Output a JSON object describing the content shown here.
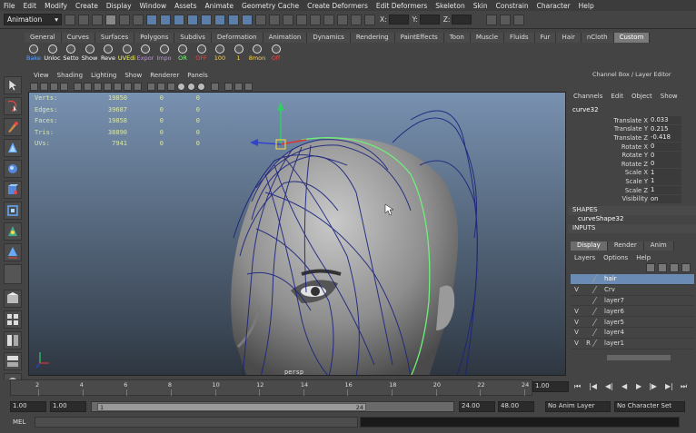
{
  "menubar": [
    "File",
    "Edit",
    "Modify",
    "Create",
    "Display",
    "Window",
    "Assets",
    "Animate",
    "Geometry Cache",
    "Create Deformers",
    "Edit Deformers",
    "Skeleton",
    "Skin",
    "Constrain",
    "Character",
    "Help"
  ],
  "status": {
    "mode": "Animation",
    "x_label": "X:",
    "y_label": "Y:",
    "z_label": "Z:"
  },
  "shelf_tabs": [
    "General",
    "Curves",
    "Surfaces",
    "Polygons",
    "Subdivs",
    "Deformation",
    "Animation",
    "Dynamics",
    "Rendering",
    "PaintEffects",
    "Toon",
    "Muscle",
    "Fluids",
    "Fur",
    "Hair",
    "nCloth",
    "Custom"
  ],
  "shelf_buttons": [
    {
      "label": "Bake",
      "color": "#5aa0ff"
    },
    {
      "label": "Unloc",
      "color": "#ffffff"
    },
    {
      "label": "Setto",
      "color": "#ffffff"
    },
    {
      "label": "Show",
      "color": "#ffffff"
    },
    {
      "label": "Reve",
      "color": "#ffffff"
    },
    {
      "label": "UVEdi",
      "color": "#ffff60"
    },
    {
      "label": "Expor",
      "color": "#d080ff"
    },
    {
      "label": "Impo",
      "color": "#d080ff"
    },
    {
      "label": "OR",
      "color": "#80ff80"
    },
    {
      "label": "OFF",
      "color": "#ff4040"
    },
    {
      "label": "100",
      "color": "#ffd040"
    },
    {
      "label": "1",
      "color": "#ffd040"
    },
    {
      "label": "8mon",
      "color": "#ffd040"
    },
    {
      "label": "Off",
      "color": "#ff4040"
    }
  ],
  "panel_menu": [
    "View",
    "Shading",
    "Lighting",
    "Show",
    "Renderer",
    "Panels"
  ],
  "hud": [
    {
      "k": "Verts:",
      "v1": "19850",
      "v2": "0",
      "v3": "0"
    },
    {
      "k": "Edges:",
      "v1": "39687",
      "v2": "0",
      "v3": "0"
    },
    {
      "k": "Faces:",
      "v1": "19858",
      "v2": "0",
      "v3": "0"
    },
    {
      "k": "Tris:",
      "v1": "38890",
      "v2": "0",
      "v3": "0"
    },
    {
      "k": "UVs:",
      "v1": "7941",
      "v2": "0",
      "v3": "0"
    }
  ],
  "camera_label": "persp",
  "channelbox": {
    "title": "Channel Box / Layer Editor",
    "menu": [
      "Channels",
      "Edit",
      "Object",
      "Show"
    ],
    "object": "curve32",
    "attributes": [
      {
        "name": "Translate X",
        "value": "0.033"
      },
      {
        "name": "Translate Y",
        "value": "0.215"
      },
      {
        "name": "Translate Z",
        "value": "-0.418"
      },
      {
        "name": "Rotate X",
        "value": "0"
      },
      {
        "name": "Rotate Y",
        "value": "0"
      },
      {
        "name": "Rotate Z",
        "value": "0"
      },
      {
        "name": "Scale X",
        "value": "1"
      },
      {
        "name": "Scale Y",
        "value": "1"
      },
      {
        "name": "Scale Z",
        "value": "1"
      },
      {
        "name": "Visibility",
        "value": "on"
      }
    ],
    "shapes_label": "SHAPES",
    "shape_name": "curveShape32",
    "inputs_label": "INPUTS"
  },
  "layer_editor": {
    "tabs": [
      "Display",
      "Render",
      "Anim"
    ],
    "menu": [
      "Layers",
      "Options",
      "Help"
    ],
    "layers": [
      {
        "v": "",
        "r": "",
        "name": "hair",
        "selected": true
      },
      {
        "v": "V",
        "r": "",
        "name": "Crv",
        "selected": false
      },
      {
        "v": "",
        "r": "",
        "name": "layer7",
        "selected": false
      },
      {
        "v": "V",
        "r": "",
        "name": "layer6",
        "selected": false
      },
      {
        "v": "V",
        "r": "",
        "name": "layer5",
        "selected": false
      },
      {
        "v": "V",
        "r": "",
        "name": "layer4",
        "selected": false
      },
      {
        "v": "V",
        "r": "R",
        "name": "layer1",
        "selected": false
      }
    ]
  },
  "timeline": {
    "ticks": [
      "2",
      "4",
      "6",
      "8",
      "10",
      "12",
      "14",
      "16",
      "18",
      "20",
      "22",
      "24"
    ],
    "current_frame": "1.00"
  },
  "range": {
    "start": "1.00",
    "start_inner": "1.00",
    "handle_start": "1",
    "handle_end": "24",
    "end_inner": "24.00",
    "end": "48.00",
    "anim_layer": "No Anim Layer",
    "character_set": "No Character Set"
  },
  "cmdline": {
    "label": "MEL"
  }
}
